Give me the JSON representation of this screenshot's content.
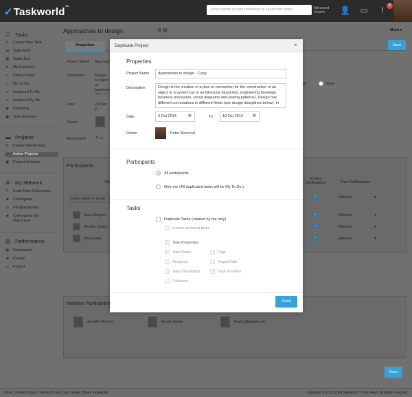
{
  "app": {
    "logo": "Taskworld",
    "logo_tm": "™"
  },
  "topbar": {
    "search_placeholder": "Enter words or task reference to search for tasks",
    "advanced_search": "Advanced Search",
    "notification_count": "8"
  },
  "sidebar": {
    "tasks_title": "Tasks",
    "tasks_items": [
      "Create New Task",
      "Task Feed",
      "Tasks Due",
      "My Favorites",
      "Critical Tasks",
      "My To Do",
      "Assigned To Me",
      "Assigned By Me",
      "Following",
      "Task Archives"
    ],
    "projects_title": "Projects",
    "projects_items": [
      "Create New Project",
      "Active Projects",
      "Project Archives"
    ],
    "network_title": "My Network",
    "network_items": [
      "Invite New Colleagues",
      "Colleagues",
      "Pending Invites",
      "Colleagues You May Know"
    ],
    "performance_title": "Performance",
    "performance_items": [
      "Dashboard",
      "People",
      "Project"
    ]
  },
  "background": {
    "page_title": "Approaches to design",
    "more": "More",
    "save": "Save",
    "tab_properties": "Properties",
    "labels": {
      "project_name": "Project Name",
      "description": "Description",
      "date": "Date",
      "owner": "Owner",
      "attachment": "Attachment"
    },
    "project_name_value": "Approaches",
    "description_value": "Design is object or business different some ca",
    "date_value": "23 Sep 2",
    "none_label": "None",
    "participants_title": "Participants",
    "name_col": "Na",
    "add_name_placeholder": "Enter name or email",
    "col_project_notifications": "Project Notifications",
    "col_task_notifications": "Task Notifications",
    "participants": [
      {
        "name": "Sara Morgan",
        "task_notification": "Related"
      },
      {
        "name": "Wesley Quinn",
        "task_notification": "Related"
      },
      {
        "name": "Zoe Dylan",
        "task_notification": "Related"
      }
    ],
    "first_row_notification": "Related",
    "inactive_title": "Inactive Participants",
    "inactive": [
      "Jennifer Rocher",
      "Morris Harris",
      "Paul.g@gmail.com"
    ]
  },
  "footer": {
    "links": "Home | Privacy Policy | Terms of Use | User Guide | Share Taskworld",
    "copyright": "Copyright © 2013-2014 Taskworld™ Pat. Pend. All rights reserved."
  },
  "modal": {
    "title": "Duplicate Project",
    "close": "×",
    "properties_heading": "Properties",
    "project_name_label": "Project Name",
    "project_name_value": "Approaches to design - Copy",
    "description_label": "Description",
    "description_value": "Design is the creation of a plan or convention for the construction of an object or a system (as in architectural blueprints, engineering drawings, business processes, circuit diagrams and sewing patterns). Design has different connotations in different fields (see design disciplines below). In",
    "date_label": "Date",
    "date_from": "3 Oct 2014",
    "to_label": "To",
    "date_to": "10 Oct 2014",
    "owner_label": "Owner",
    "owner_name": "Peter Macnicol",
    "participants_heading": "Participants",
    "all_participants": "All participants",
    "only_me": "Only me (All duplicated tasks will be My To-Do.)",
    "tasks_heading": "Tasks",
    "duplicate_tasks": "Duplicate Tasks (created by me only)",
    "include_archived": "Include archived tasks",
    "task_properties": "Task Properties",
    "task_name": "Task Name",
    "tags": "Tags",
    "assignee": "Assignee",
    "target_date": "Target Date",
    "task_description": "Task Description",
    "task_priorities": "Task Priorities",
    "followers": "Followers",
    "save": "Save"
  },
  "colors": {
    "accent": "#39a0d8",
    "topbar": "#2b2b2b"
  }
}
